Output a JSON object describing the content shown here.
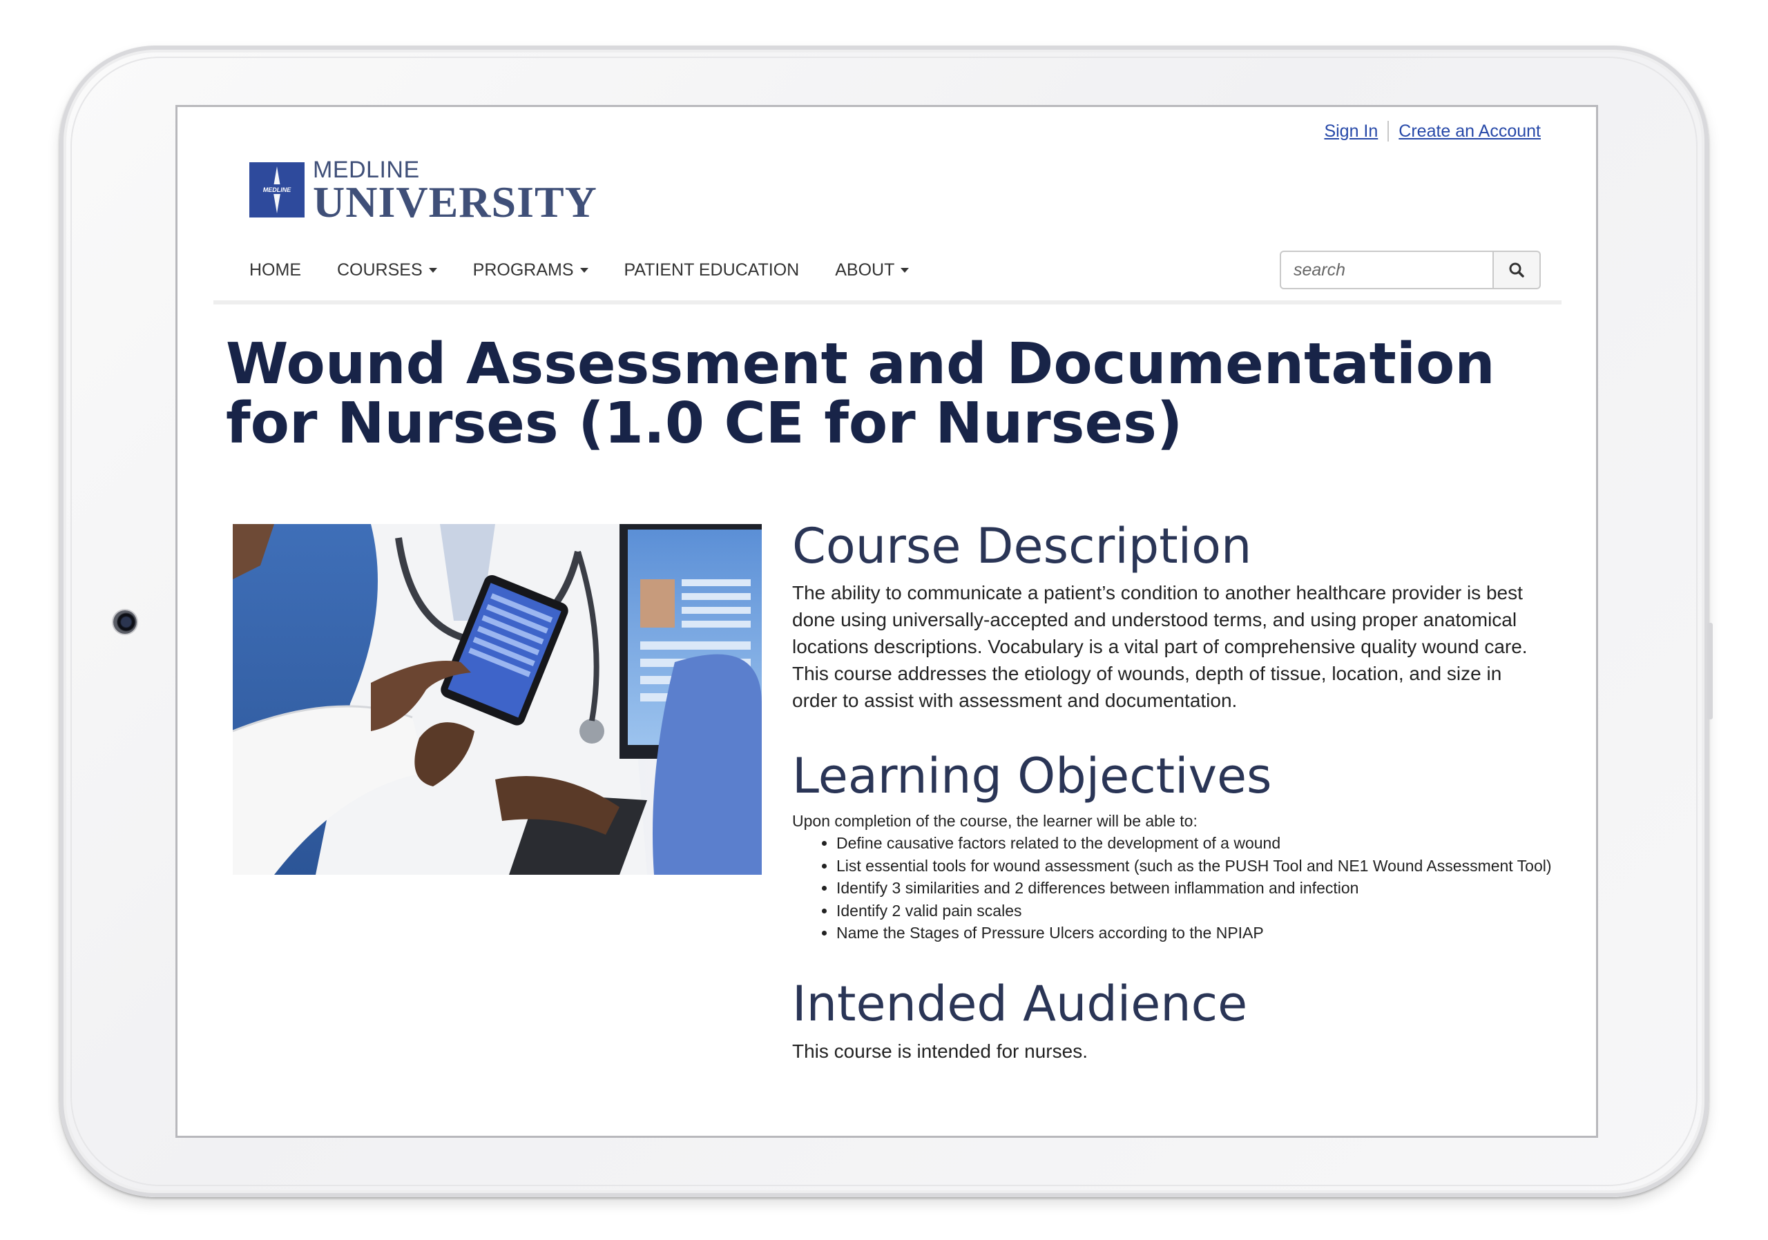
{
  "top_links": {
    "sign_in": "Sign In",
    "create_account": "Create an Account"
  },
  "logo": {
    "top": "MEDLINE",
    "bottom": "UNIVERSITY",
    "mark_text": "MEDLINE"
  },
  "nav": {
    "items": [
      {
        "label": "HOME",
        "has_caret": false
      },
      {
        "label": "COURSES",
        "has_caret": true
      },
      {
        "label": "PROGRAMS",
        "has_caret": true
      },
      {
        "label": "PATIENT EDUCATION",
        "has_caret": false
      },
      {
        "label": "ABOUT",
        "has_caret": true
      }
    ]
  },
  "search": {
    "placeholder": "search",
    "value": "",
    "icon": "search-icon"
  },
  "page_title": "Wound Assessment and Documentation for Nurses (1.0 CE for Nurses)",
  "hero": {
    "icon": "photo-clinicians-with-tablet"
  },
  "sections": {
    "course_description": {
      "heading": "Course Description",
      "body": "The ability to communicate a patient’s condition to another healthcare provider is best done using universally-accepted and understood terms, and using proper anatomical locations descriptions. Vocabulary is a vital part of comprehensive quality wound care. This course addresses the etiology of wounds, depth of tissue, location, and size in order to assist with assessment and documentation."
    },
    "learning_objectives": {
      "heading": "Learning Objectives",
      "intro": "Upon completion of the course, the learner will be able to:",
      "items": [
        "Define causative factors related to the development of a wound",
        "List essential tools for wound assessment (such as the PUSH Tool and NE1 Wound Assessment Tool)",
        "Identify 3 similarities and 2 differences between inflammation and infection",
        "Identify 2 valid pain scales",
        "Name the Stages of Pressure Ulcers according to the NPIAP"
      ]
    },
    "intended_audience": {
      "heading": "Intended Audience",
      "body": "This course is intended for nurses."
    }
  },
  "colors": {
    "title": "#182448",
    "heading": "#2a3556",
    "link": "#2648a8",
    "logo": "#3f4f78",
    "logo_mark": "#2e4a9c"
  }
}
